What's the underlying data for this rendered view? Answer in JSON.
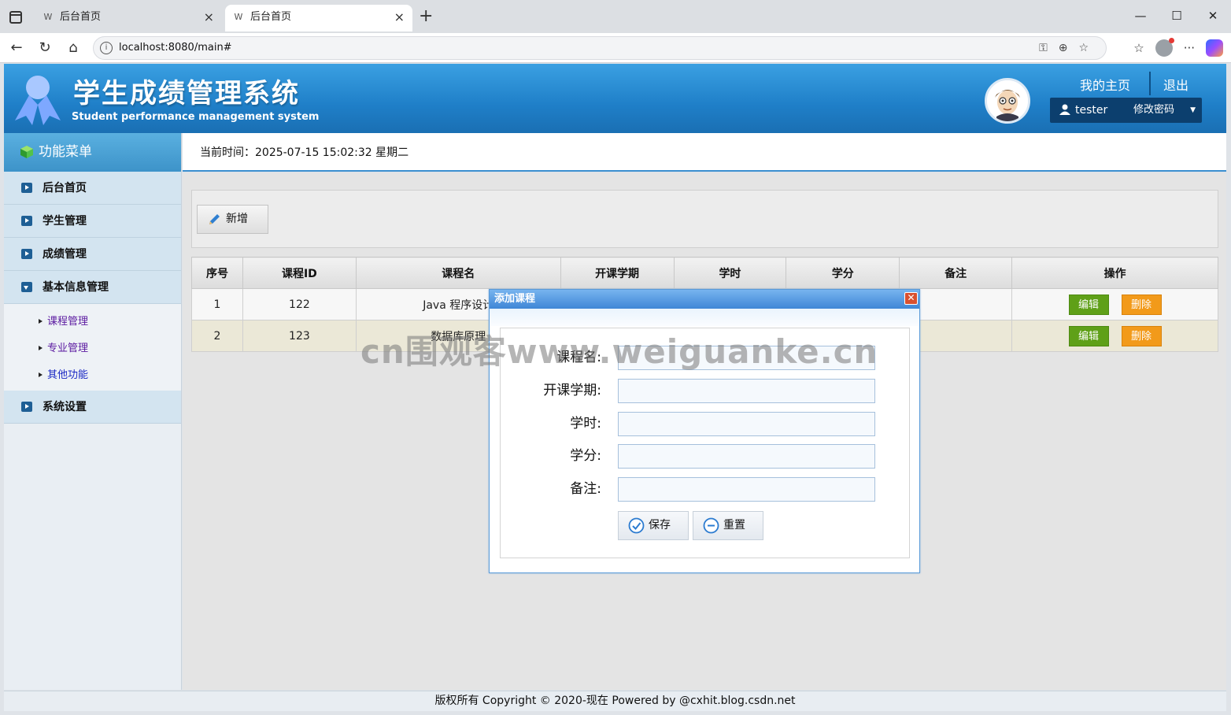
{
  "browser": {
    "tabs": [
      {
        "title": "后台首页",
        "favicon": "W"
      },
      {
        "title": "后台首页",
        "favicon": "W"
      }
    ],
    "url": "localhost:8080/main#"
  },
  "header": {
    "title": "学生成绩管理系统",
    "subtitle": "Student performance management system",
    "links": {
      "home": "我的主页",
      "logout": "退出"
    },
    "user": {
      "name": "tester",
      "change_password": "修改密码"
    }
  },
  "sidebar": {
    "title": "功能菜单",
    "items": [
      {
        "label": "后台首页"
      },
      {
        "label": "学生管理"
      },
      {
        "label": "成绩管理"
      },
      {
        "label": "基本信息管理"
      },
      {
        "label": "系统设置"
      }
    ],
    "sub_items": [
      {
        "label": "课程管理"
      },
      {
        "label": "专业管理"
      },
      {
        "label": "其他功能"
      }
    ]
  },
  "timebar": {
    "text": "当前时间：2025-07-15 15:02:32 星期二"
  },
  "toolbar": {
    "add_label": "新增"
  },
  "table": {
    "columns": [
      "序号",
      "课程ID",
      "课程名",
      "开课学期",
      "学时",
      "学分",
      "备注",
      "操作"
    ],
    "rows": [
      {
        "index": "1",
        "id": "122",
        "name": "Java 程序设计",
        "term": "",
        "hours": "",
        "credit": "",
        "remark": ""
      },
      {
        "index": "2",
        "id": "123",
        "name": "数据库原理",
        "term": "",
        "hours": "",
        "credit": "",
        "remark": ""
      }
    ],
    "edit_label": "编辑",
    "delete_label": "删除"
  },
  "dialog": {
    "title": "添加课程",
    "fields": [
      {
        "label": "课程名:",
        "value": ""
      },
      {
        "label": "开课学期:",
        "value": ""
      },
      {
        "label": "学时:",
        "value": ""
      },
      {
        "label": "学分:",
        "value": ""
      },
      {
        "label": "备注:",
        "value": ""
      }
    ],
    "save_label": "保存",
    "reset_label": "重置"
  },
  "watermark": "cn围观客www.weiguanke.cn",
  "footer": {
    "text": "版权所有 Copyright © 2020-现在 Powered by @cxhit.blog.csdn.net"
  },
  "colors": {
    "header_blue": "#1f7fc8",
    "edit_green": "#5fa018",
    "delete_orange": "#f29a1a"
  }
}
